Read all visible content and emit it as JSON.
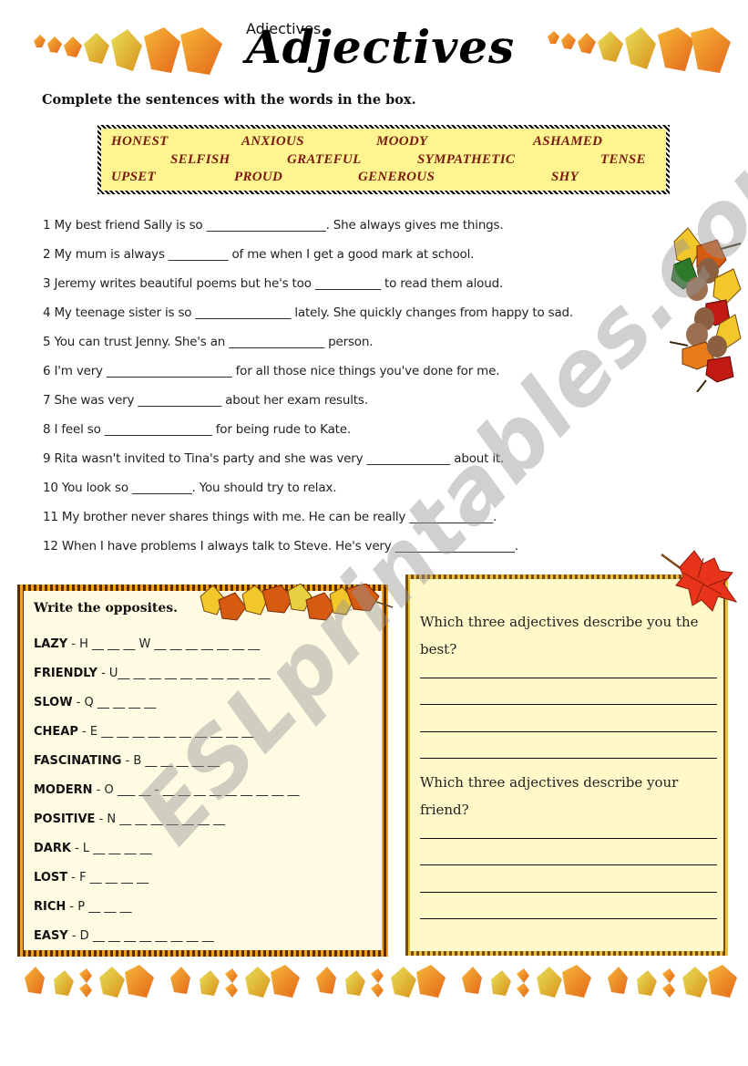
{
  "header": {
    "title": "Adjectives",
    "instructions": "Complete the sentences with the words in the box."
  },
  "word_box": {
    "words": [
      "HONEST",
      "ANXIOUS",
      "MOODY",
      "ASHAMED",
      "SELFISH",
      "GRATEFUL",
      "SYMPATHETIC",
      "TENSE",
      "UPSET",
      "PROUD",
      "GENEROUS",
      "SHY"
    ]
  },
  "sentences": [
    {
      "before": "1 My best friend Sally is so ",
      "blank": "____________________",
      "after": ". She always gives me things."
    },
    {
      "before": "2 My mum is always  ",
      "blank": "__________",
      "after": " of me when I get a good mark at school."
    },
    {
      "before": "3 Jeremy writes beautiful poems but he's too ",
      "blank": "___________",
      "after": " to read them aloud."
    },
    {
      "before": "4 My teenage sister is so ",
      "blank": "________________",
      "after": " lately. She quickly changes from happy to sad."
    },
    {
      "before": "5 You can trust Jenny. She's an ",
      "blank": "________________",
      "after": " person."
    },
    {
      "before": "6 I'm very ",
      "blank": "_____________________",
      "after": " for all those nice things you've done for me."
    },
    {
      "before": "7 She was very ",
      "blank": "______________",
      "after": " about her exam results."
    },
    {
      "before": "8 I feel so ",
      "blank": "__________________",
      "after": " for being rude to Kate."
    },
    {
      "before": "9 Rita wasn't invited to Tina's party and she was very ",
      "blank": "______________",
      "after": " about it."
    },
    {
      "before": "10 You look so ",
      "blank": "__________",
      "after": ". You should try to relax."
    },
    {
      "before": "11 My brother never shares things with me. He can be really ",
      "blank": "______________",
      "after": "."
    },
    {
      "before": "12 When I have problems I always talk to Steve. He's very ",
      "blank": "____________________",
      "after": "."
    }
  ],
  "opposites": {
    "title": "Write the opposites.",
    "items": [
      {
        "word": "LAZY",
        "hint": " - H __ __ __    W __ __ __ __ __ __ __"
      },
      {
        "word": "FRIENDLY",
        "hint": " -   U__ __ __ __ __ __ __ __ __ __"
      },
      {
        "word": "SLOW",
        "hint": " - Q __ __ __ __"
      },
      {
        "word": "CHEAP",
        "hint": " - E __ __ __ __ __ __ __ __ __ __"
      },
      {
        "word": "FASCINATING",
        "hint": " - B __ __ __ __ __"
      },
      {
        "word": "MODERN",
        "hint": " - O ___ __ - __ __ __ __ __ __ __ __ __"
      },
      {
        "word": "POSITIVE",
        "hint": " - N __ __ __ __ __ __ __"
      },
      {
        "word": "DARK",
        "hint": " - L __ __ __ __"
      },
      {
        "word": "LOST",
        "hint": " - F __ __ __ __"
      },
      {
        "word": "RICH",
        "hint": " - P __ __ __"
      },
      {
        "word": "EASY",
        "hint": " - D __ __ __ __ __ __ __ __"
      }
    ]
  },
  "questions": [
    {
      "text": "Which three adjectives describe you the best?",
      "answer_lines": 4
    },
    {
      "text": "Which three adjectives describe your friend?",
      "answer_lines": 4
    }
  ],
  "watermark": "ESLprintables.com",
  "colors": {
    "word_box_bg": "#fff590",
    "word_text": "#7a1a10",
    "opposites_bg": "#fffbe3",
    "questions_bg": "#fff8c8",
    "leaf_orange": "#e8761a",
    "leaf_yellow": "#e8c52a"
  }
}
